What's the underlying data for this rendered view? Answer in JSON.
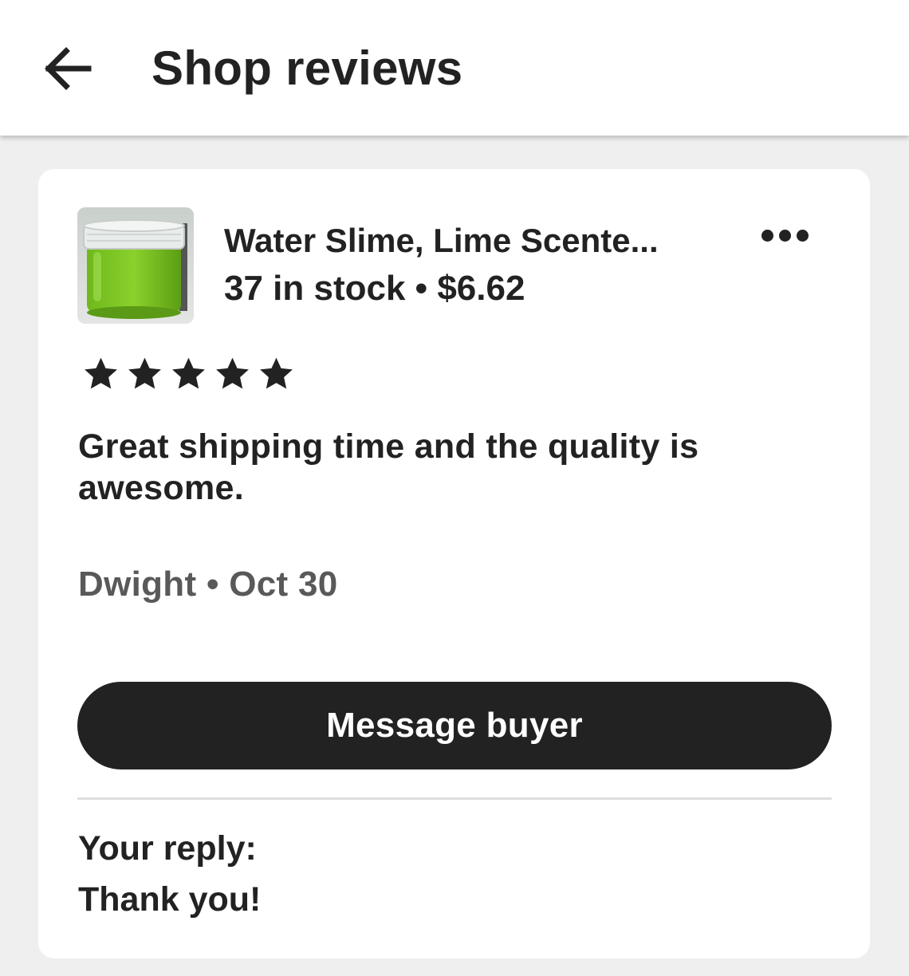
{
  "header": {
    "title": "Shop reviews",
    "back_icon": "arrow-left-icon"
  },
  "review": {
    "item": {
      "title": "Water Slime, Lime Scente...",
      "stock": "37 in stock",
      "separator": "•",
      "price": "$6.62",
      "thumbnail_icon": "product-thumbnail",
      "colors": {
        "slime": "#7cc424",
        "jar": "#e7ebe8"
      }
    },
    "more_icon": "more-horizontal-icon",
    "rating": {
      "value": 5,
      "max": 5
    },
    "text": "Great shipping time and the quality is awesome.",
    "reviewer": "Dwight",
    "date_separator": "•",
    "date": "Oct 30",
    "message_button_label": "Message buyer",
    "reply_label": "Your reply:",
    "reply_text": "Thank you!"
  },
  "colors": {
    "background": "#efefef",
    "card": "#ffffff",
    "primary_text": "#222222",
    "secondary_text": "#595959",
    "button": "#222222",
    "button_text": "#ffffff",
    "divider": "#dedede"
  }
}
